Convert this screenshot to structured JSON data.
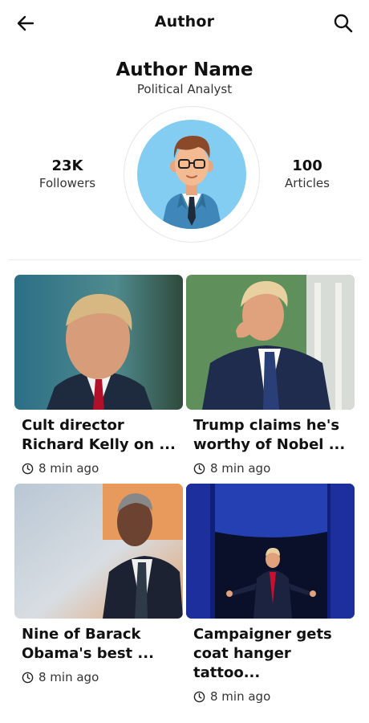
{
  "header": {
    "title": "Author",
    "back_icon": "arrow-left-icon",
    "search_icon": "search-icon"
  },
  "profile": {
    "name": "Author Name",
    "role": "Political Analyst",
    "followers_count": "23K",
    "followers_label": "Followers",
    "articles_count": "100",
    "articles_label": "Articles",
    "avatar_bg": "#84cdf2"
  },
  "articles": [
    {
      "title": "Cult director\nRichard Kelly on ...",
      "time": "8 min ago"
    },
    {
      "title": "Trump claims he's\nworthy of Nobel ...",
      "time": "8 min ago"
    },
    {
      "title": "Nine of Barack\nObama's best ...",
      "time": "8 min ago"
    },
    {
      "title": "Campaigner gets\ncoat hanger tattoo...",
      "time": "8 min ago"
    }
  ]
}
